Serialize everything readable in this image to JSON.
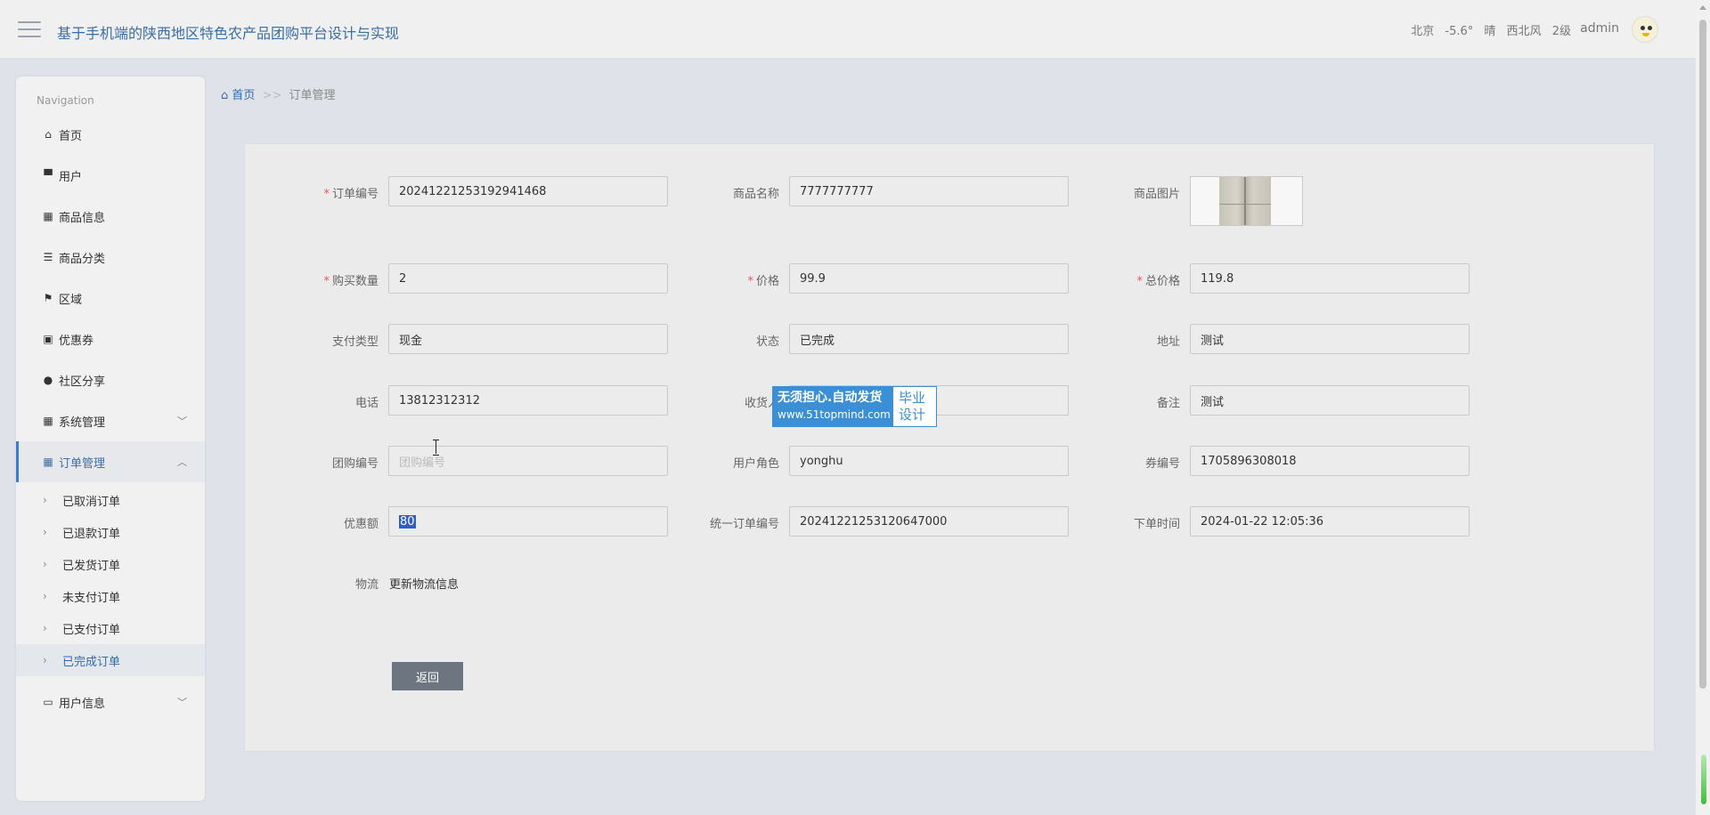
{
  "header": {
    "title": "基于手机端的陕西地区特色农产品团购平台设计与实现",
    "weather": {
      "city": "北京",
      "temp": "-5.6°",
      "condition": "晴",
      "wind": "西北风",
      "level": "2级"
    },
    "user": "admin"
  },
  "sidebar": {
    "nav_title": "Navigation",
    "items": [
      {
        "label": "首页",
        "icon": "home-icon"
      },
      {
        "label": "用户",
        "icon": "user-icon"
      },
      {
        "label": "商品信息",
        "icon": "grid-icon"
      },
      {
        "label": "商品分类",
        "icon": "list-icon"
      },
      {
        "label": "区域",
        "icon": "flag-icon"
      },
      {
        "label": "优惠券",
        "icon": "coupon-icon"
      },
      {
        "label": "社区分享",
        "icon": "share-icon"
      },
      {
        "label": "系统管理",
        "icon": "grid-icon"
      },
      {
        "label": "订单管理",
        "icon": "grid-icon"
      }
    ],
    "sub_items": [
      "已取消订单",
      "已退款订单",
      "已发货订单",
      "未支付订单",
      "已支付订单",
      "已完成订单"
    ],
    "last_item": {
      "label": "用户信息",
      "icon": "card-icon"
    }
  },
  "breadcrumb": {
    "home": "首页",
    "sep": ">>",
    "current": "订单管理"
  },
  "form": {
    "order_no": {
      "label": "订单编号",
      "value": "20241221253192941468"
    },
    "product_name": {
      "label": "商品名称",
      "value": "7777777777"
    },
    "product_image": {
      "label": "商品图片"
    },
    "quantity": {
      "label": "购买数量",
      "value": "2"
    },
    "price": {
      "label": "价格",
      "value": "99.9"
    },
    "total": {
      "label": "总价格",
      "value": "119.8"
    },
    "pay_type": {
      "label": "支付类型",
      "value": "现金"
    },
    "status": {
      "label": "状态",
      "value": "已完成"
    },
    "address": {
      "label": "地址",
      "value": "测试"
    },
    "phone": {
      "label": "电话",
      "value": "13812312312"
    },
    "receiver": {
      "label": "收货人",
      "value": ""
    },
    "remark": {
      "label": "备注",
      "value": "测试"
    },
    "group_no": {
      "label": "团购编号",
      "placeholder": "团购编号"
    },
    "user_role": {
      "label": "用户角色",
      "value": "yonghu"
    },
    "coupon_no": {
      "label": "券编号",
      "value": "1705896308018"
    },
    "discount": {
      "label": "优惠额",
      "value": "80"
    },
    "unified_no": {
      "label": "统一订单编号",
      "value": "20241221253120647000"
    },
    "order_time": {
      "label": "下单时间",
      "value": "2024-01-22 12:05:36"
    },
    "logistics": {
      "label": "物流",
      "value": "更新物流信息"
    },
    "back_button": "返回"
  },
  "watermark": {
    "line1": "无须担心.自动发货",
    "line2": "www.51topmind.com",
    "right1": "毕业",
    "right2": "设计"
  }
}
